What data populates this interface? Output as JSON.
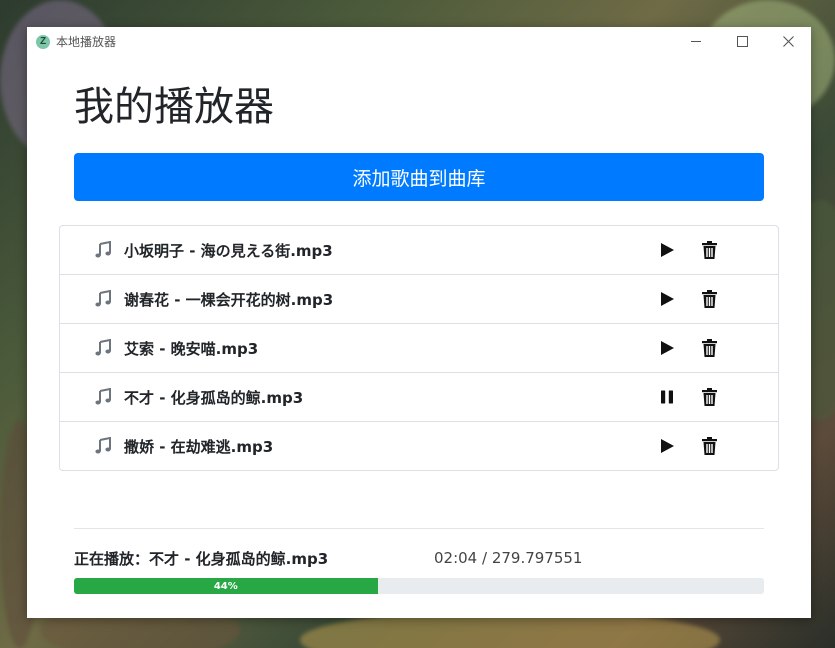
{
  "window": {
    "title": "本地播放器",
    "app_icon_letter": "Z"
  },
  "page": {
    "title": "我的播放器",
    "add_button_label": "添加歌曲到曲库"
  },
  "songs": [
    {
      "name": "小坂明子 - 海の見える街.mp3",
      "state": "paused",
      "action_icon": "play-icon"
    },
    {
      "name": "谢春花 - 一棵会开花的树.mp3",
      "state": "paused",
      "action_icon": "play-icon"
    },
    {
      "name": "艾索 - 晚安喵.mp3",
      "state": "paused",
      "action_icon": "play-icon"
    },
    {
      "name": "不才 - 化身孤岛的鲸.mp3",
      "state": "playing",
      "action_icon": "pause-icon"
    },
    {
      "name": "撒娇 - 在劫难逃.mp3",
      "state": "paused",
      "action_icon": "play-icon"
    }
  ],
  "now_playing": {
    "label": "正在播放：不才 - 化身孤岛的鲸.mp3",
    "time": "02:04 / 279.797551",
    "progress_percent": 44,
    "progress_label": "44%"
  },
  "colors": {
    "primary": "#007bff",
    "progress": "#28a745",
    "progress_track": "#e9ecef",
    "text": "#212529"
  }
}
